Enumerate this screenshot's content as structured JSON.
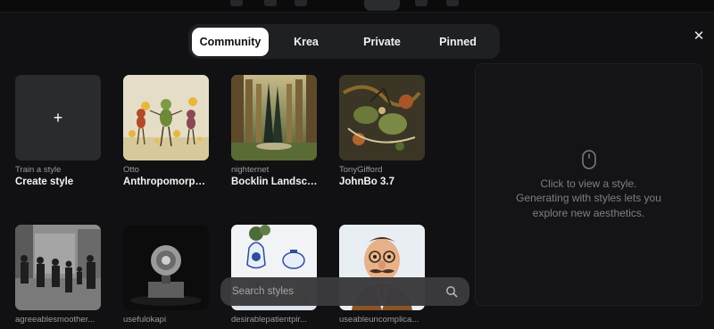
{
  "tabs": [
    {
      "label": "Community",
      "active": true
    },
    {
      "label": "Krea",
      "active": false
    },
    {
      "label": "Private",
      "active": false
    },
    {
      "label": "Pinned",
      "active": false
    }
  ],
  "create_card": {
    "author": "Train a style",
    "title": "Create style",
    "icon": "plus-icon"
  },
  "styles": [
    {
      "author": "Otto",
      "title": "Anthropomorphi..."
    },
    {
      "author": "nighternet",
      "title": "Bocklin Landsca..."
    },
    {
      "author": "TonyGifford",
      "title": "JohnBo 3.7"
    },
    {
      "author": "agreeablesmoother...",
      "title": ""
    },
    {
      "author": "usefulokapi",
      "title": ""
    },
    {
      "author": "desirablepatientpir...",
      "title": ""
    },
    {
      "author": "useableuncomplica...",
      "title": ""
    }
  ],
  "search": {
    "placeholder": "Search styles",
    "icon": "search-icon"
  },
  "preview": {
    "line1": "Click to view a style.",
    "line2": "Generating with styles lets you",
    "line3": "explore new aesthetics.",
    "icon": "mouse-icon"
  },
  "close": {
    "icon": "close-icon",
    "label": "✕"
  },
  "colors": {
    "background": "#111113",
    "panel": "#1f2023",
    "active_tab": "#ffffff",
    "search": "#3b3b3e"
  }
}
